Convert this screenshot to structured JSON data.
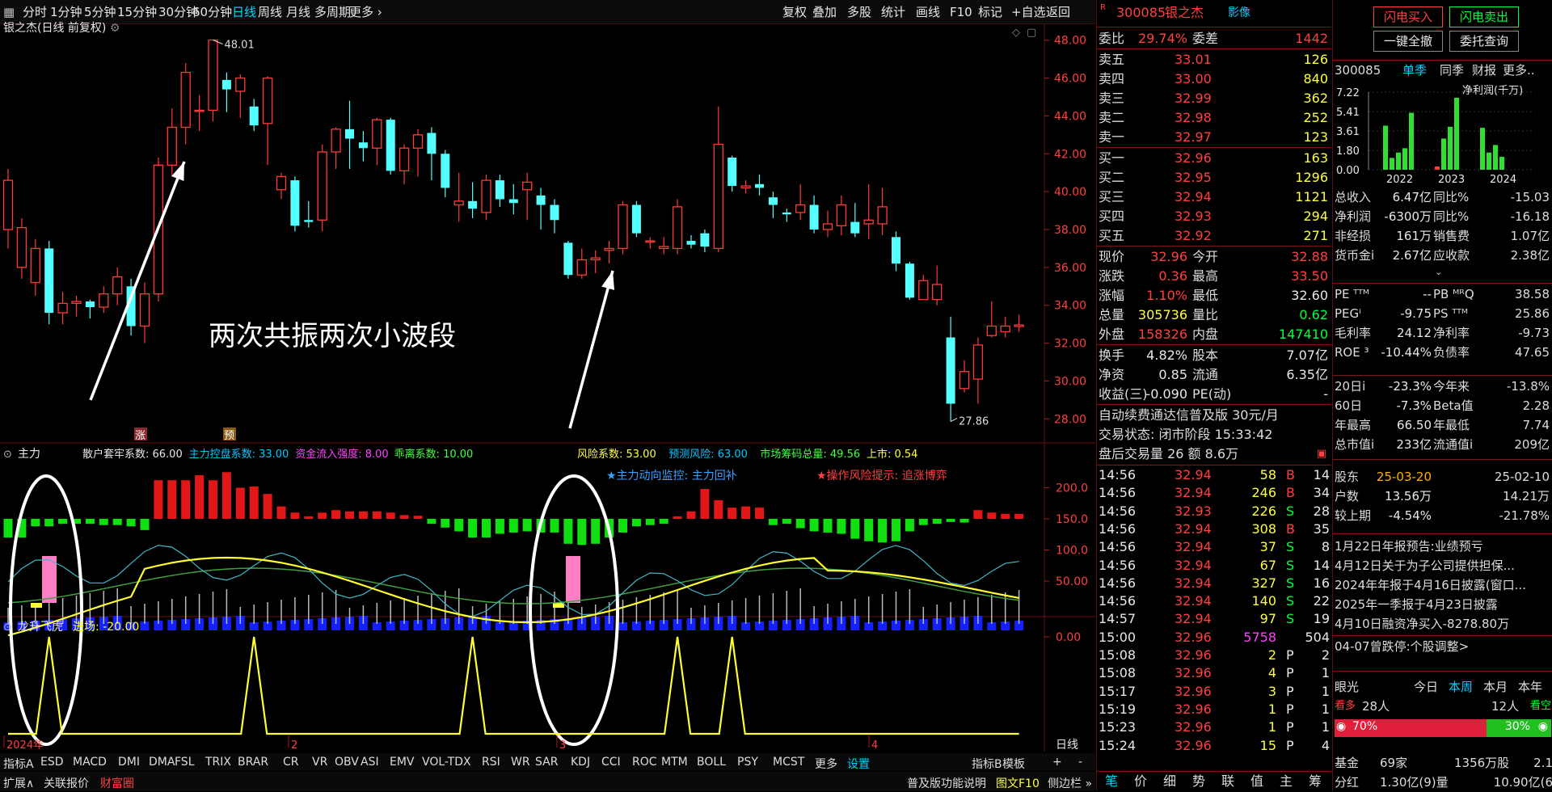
{
  "toolbar": {
    "periods": [
      "分时",
      "1分钟",
      "5分钟",
      "15分钟",
      "30分钟",
      "60分钟",
      "日线",
      "周线",
      "月线",
      "多周期",
      "更多 ›"
    ],
    "selected": "日线",
    "right": [
      "复权",
      "叠加",
      "多股",
      "统计",
      "画线",
      "F10",
      "标记",
      "+自选",
      "返回"
    ]
  },
  "chart": {
    "title": "银之杰(日线 前复权)",
    "high_label": "48.01",
    "low_label": "27.86",
    "annotation": "两次共振两次小波段",
    "price_ticks": [
      "48.00",
      "46.00",
      "44.00",
      "42.00",
      "40.00",
      "38.00",
      "36.00",
      "34.00",
      "32.00",
      "30.00",
      "28.00"
    ],
    "markers": [
      "涨",
      "预"
    ],
    "ind1_name": "主力",
    "ind1_params": [
      {
        "text": "散户套牢系数: 66.00",
        "color": "#e8e8e8"
      },
      {
        "text": "主力控盘系数: 33.00",
        "color": "#00c8ff"
      },
      {
        "text": "资金流入强度: 8.00",
        "color": "#ff40ff"
      },
      {
        "text": "乖离系数: 10.00",
        "color": "#40ff40"
      },
      {
        "text": "风险系数: 53.00",
        "color": "#ffff40"
      },
      {
        "text": "预测风险: 63.00",
        "color": "#00c8ff"
      },
      {
        "text": "市场筹码总量: 49.56",
        "color": "#40ff40"
      },
      {
        "text": "上市: 0.54",
        "color": "#ffff40"
      }
    ],
    "ind1_monitor": "★主力动向监控: 主力回补",
    "ind1_risk": "★操作风险提示: 追涨博弈",
    "ind1_ticks": [
      "200.0",
      "150.0",
      "100.0",
      "50.00"
    ],
    "ind2_name": "龙升飞虎",
    "ind2_param": "进场: -20.00",
    "ind2_tick": "0.00",
    "xlabels": [
      "2024年",
      "2",
      "3",
      "4"
    ],
    "period_label": "日线"
  },
  "chart_data": {
    "type": "candlestick",
    "symbol": "300085",
    "y_range": [
      27.5,
      48.5
    ],
    "candles": [
      [
        38.0,
        40.6,
        37.0,
        41.2
      ],
      [
        36.0,
        38.1,
        35.4,
        38.6
      ],
      [
        35.2,
        37.0,
        34.5,
        37.5
      ],
      [
        37.0,
        33.6,
        33.0,
        37.4
      ],
      [
        33.6,
        34.1,
        33.0,
        34.7
      ],
      [
        34.1,
        34.2,
        33.4,
        34.5
      ],
      [
        34.2,
        33.9,
        33.3,
        34.3
      ],
      [
        33.9,
        34.6,
        33.6,
        35.0
      ],
      [
        34.6,
        35.5,
        34.0,
        36.0
      ],
      [
        35.0,
        32.9,
        32.4,
        35.4
      ],
      [
        32.9,
        34.6,
        32.0,
        35.2
      ],
      [
        34.6,
        41.4,
        34.2,
        41.8
      ],
      [
        41.4,
        43.4,
        40.8,
        44.4
      ],
      [
        43.4,
        46.3,
        42.5,
        46.8
      ],
      [
        44.3,
        44.3,
        43.2,
        45.1
      ],
      [
        44.3,
        48.01,
        43.7,
        48.01
      ],
      [
        45.9,
        45.4,
        44.2,
        46.3
      ],
      [
        45.3,
        46.0,
        43.9,
        46.2
      ],
      [
        44.5,
        43.5,
        43.2,
        44.9
      ],
      [
        43.6,
        46.0,
        41.4,
        46.1
      ],
      [
        40.1,
        40.8,
        39.6,
        41.0
      ],
      [
        40.6,
        38.2,
        37.9,
        40.8
      ],
      [
        38.5,
        38.4,
        38.1,
        39.5
      ],
      [
        38.5,
        42.1,
        37.9,
        42.5
      ],
      [
        42.1,
        43.3,
        41.2,
        43.4
      ],
      [
        43.3,
        42.8,
        41.2,
        44.8
      ],
      [
        42.6,
        42.3,
        41.6,
        43.2
      ],
      [
        42.3,
        43.8,
        41.4,
        43.9
      ],
      [
        43.8,
        41.1,
        40.9,
        43.9
      ],
      [
        41.1,
        42.3,
        40.4,
        42.5
      ],
      [
        42.3,
        43.0,
        40.8,
        43.3
      ],
      [
        43.1,
        42.0,
        40.6,
        43.4
      ],
      [
        42.0,
        40.2,
        39.7,
        42.2
      ],
      [
        39.3,
        39.5,
        38.4,
        41.0
      ],
      [
        39.5,
        39.1,
        38.6,
        40.5
      ],
      [
        38.9,
        40.6,
        38.5,
        40.9
      ],
      [
        40.6,
        39.6,
        39.2,
        40.9
      ],
      [
        39.6,
        39.4,
        38.8,
        40.4
      ],
      [
        40.1,
        40.5,
        38.5,
        41.0
      ],
      [
        39.8,
        39.3,
        38.0,
        40.2
      ],
      [
        39.3,
        38.5,
        37.8,
        39.6
      ],
      [
        37.3,
        35.6,
        35.4,
        37.4
      ],
      [
        35.6,
        36.4,
        35.4,
        37.0
      ],
      [
        36.4,
        36.5,
        35.7,
        36.9
      ],
      [
        36.9,
        37.0,
        36.2,
        37.4
      ],
      [
        37.0,
        39.3,
        36.7,
        39.5
      ],
      [
        39.3,
        37.8,
        37.6,
        39.5
      ],
      [
        37.4,
        37.4,
        37.0,
        37.6
      ],
      [
        37.0,
        37.1,
        36.7,
        37.6
      ],
      [
        37.0,
        39.2,
        36.7,
        39.6
      ],
      [
        37.4,
        37.2,
        37.0,
        37.7
      ],
      [
        37.8,
        37.1,
        36.8,
        38.0
      ],
      [
        37.0,
        42.5,
        36.8,
        44.5
      ],
      [
        41.8,
        40.3,
        40.0,
        41.9
      ],
      [
        40.2,
        40.3,
        39.9,
        40.6
      ],
      [
        40.4,
        40.2,
        39.8,
        40.9
      ],
      [
        39.7,
        39.3,
        38.6,
        40.0
      ],
      [
        38.9,
        38.8,
        38.4,
        39.1
      ],
      [
        38.9,
        39.3,
        38.5,
        40.4
      ],
      [
        39.3,
        38.0,
        37.8,
        39.8
      ],
      [
        38.0,
        38.3,
        37.6,
        39.0
      ],
      [
        38.2,
        39.3,
        37.7,
        39.8
      ],
      [
        38.4,
        37.8,
        37.6,
        39.4
      ],
      [
        38.3,
        38.5,
        37.5,
        40.4
      ],
      [
        38.3,
        39.2,
        37.7,
        40.2
      ],
      [
        37.6,
        36.2,
        35.8,
        37.9
      ],
      [
        36.2,
        34.4,
        34.3,
        36.3
      ],
      [
        34.3,
        35.3,
        34.3,
        35.6
      ],
      [
        34.3,
        35.1,
        34.0,
        36.1
      ],
      [
        32.3,
        28.8,
        27.86,
        33.4
      ],
      [
        29.6,
        30.5,
        29.4,
        31.1
      ],
      [
        30.1,
        31.9,
        28.8,
        32.3
      ],
      [
        32.4,
        32.9,
        32.3,
        34.2
      ],
      [
        32.6,
        32.9,
        32.3,
        33.4
      ],
      [
        32.88,
        32.96,
        32.6,
        33.5
      ]
    ]
  },
  "quote": {
    "code": "300085",
    "name": "银之杰",
    "tag": "影像",
    "weibi_label": "委比",
    "weibi": "29.74%",
    "weicha_label": "委差",
    "weicha": "1442",
    "asks": [
      {
        "l": "卖五",
        "p": "33.01",
        "v": "126"
      },
      {
        "l": "卖四",
        "p": "33.00",
        "v": "840"
      },
      {
        "l": "卖三",
        "p": "32.99",
        "v": "362"
      },
      {
        "l": "卖二",
        "p": "32.98",
        "v": "252"
      },
      {
        "l": "卖一",
        "p": "32.97",
        "v": "123"
      }
    ],
    "bids": [
      {
        "l": "买一",
        "p": "32.96",
        "v": "163"
      },
      {
        "l": "买二",
        "p": "32.95",
        "v": "1296"
      },
      {
        "l": "买三",
        "p": "32.94",
        "v": "1121"
      },
      {
        "l": "买四",
        "p": "32.93",
        "v": "294"
      },
      {
        "l": "买五",
        "p": "32.92",
        "v": "271"
      }
    ],
    "stats": [
      {
        "a": "现价",
        "av": "32.96",
        "ac": "red",
        "b": "今开",
        "bv": "32.88",
        "bc": "red"
      },
      {
        "a": "涨跌",
        "av": "0.36",
        "ac": "red",
        "b": "最高",
        "bv": "33.50",
        "bc": "red"
      },
      {
        "a": "涨幅",
        "av": "1.10%",
        "ac": "red",
        "b": "最低",
        "bv": "32.60",
        "bc": "wht"
      },
      {
        "a": "总量",
        "av": "305736",
        "ac": "yel",
        "b": "量比",
        "bv": "0.62",
        "bc": "grn"
      },
      {
        "a": "外盘",
        "av": "158326",
        "ac": "red",
        "b": "内盘",
        "bv": "147410",
        "bc": "grn"
      }
    ],
    "stats2": [
      {
        "a": "换手",
        "av": "4.82%",
        "b": "股本",
        "bv": "7.07亿"
      },
      {
        "a": "净资",
        "av": "0.85",
        "b": "流通",
        "bv": "6.35亿"
      },
      {
        "a": "收益(三)",
        "av": "-0.090",
        "b": "PE(动)",
        "bv": "-"
      }
    ],
    "ad": "自动续费通达信普及版 30元/月",
    "status": "交易状态: 闭市阶段 15:33:42",
    "afterhours": "盘后交易量 26 额 8.6万",
    "ticks": [
      [
        "14:56",
        "32.94",
        "58",
        "B",
        "14"
      ],
      [
        "14:56",
        "32.94",
        "246",
        "B",
        "34"
      ],
      [
        "14:56",
        "32.93",
        "226",
        "S",
        "28"
      ],
      [
        "14:56",
        "32.94",
        "308",
        "B",
        "35"
      ],
      [
        "14:56",
        "32.94",
        "37",
        "S",
        "8"
      ],
      [
        "14:56",
        "32.94",
        "67",
        "S",
        "14"
      ],
      [
        "14:56",
        "32.94",
        "327",
        "S",
        "16"
      ],
      [
        "14:56",
        "32.94",
        "140",
        "S",
        "22"
      ],
      [
        "14:57",
        "32.94",
        "97",
        "S",
        "19"
      ],
      [
        "15:00",
        "32.96",
        "5758",
        "",
        "504"
      ],
      [
        "15:08",
        "32.96",
        "2",
        "P",
        "2"
      ],
      [
        "15:08",
        "32.96",
        "4",
        "P",
        "1"
      ],
      [
        "15:17",
        "32.96",
        "3",
        "P",
        "1"
      ],
      [
        "15:19",
        "32.96",
        "1",
        "P",
        "1"
      ],
      [
        "15:23",
        "32.96",
        "1",
        "P",
        "1"
      ],
      [
        "15:24",
        "32.96",
        "15",
        "P",
        "4"
      ]
    ],
    "bottom_tabs": [
      "笔",
      "价",
      "细",
      "势",
      "联",
      "值",
      "主",
      "筹"
    ]
  },
  "fin": {
    "btn_buy": "闪电买入",
    "btn_sell": "闪电卖出",
    "btn_cancel": "一键全撤",
    "btn_query": "委托查询",
    "code": "300085",
    "tabs": [
      "单季",
      "同季",
      "财报",
      "更多.."
    ],
    "chart_title": "净利润(千万)",
    "y_ticks": [
      "7.22",
      "5.41",
      "3.61",
      "1.80",
      "0.00"
    ],
    "years": [
      "2022",
      "2023",
      "2024"
    ],
    "rows": [
      {
        "a": "总收入",
        "av": "6.47亿",
        "b": "同比%",
        "bv": "-15.03"
      },
      {
        "a": "净利润",
        "av": "-6300万",
        "b": "同比%",
        "bv": "-16.18"
      },
      {
        "a": "非经损",
        "av": "161万",
        "b": "销售费",
        "bv": "1.07亿"
      },
      {
        "a": "货币金i",
        "av": "2.67亿",
        "b": "应收款",
        "bv": "2.38亿"
      }
    ],
    "rows2": [
      {
        "a": "PE ᵀᵀᴹ",
        "av": "--",
        "b": "PB ᴹᴿQ",
        "bv": "38.58"
      },
      {
        "a": "PEGⁱ",
        "av": "-9.75",
        "b": "PS ᵀᵀᴹ",
        "bv": "25.86"
      },
      {
        "a": "毛利率",
        "av": "24.12",
        "b": "净利率",
        "bv": "-9.73"
      },
      {
        "a": "ROE ³",
        "av": "-10.44%",
        "b": "负债率",
        "bv": "47.65"
      }
    ],
    "rows3": [
      {
        "a": "20日i",
        "av": "-23.3%",
        "b": "今年来",
        "bv": "-13.8%"
      },
      {
        "a": "60日",
        "av": "-7.3%",
        "b": "Beta值",
        "bv": "2.28"
      },
      {
        "a": "年最高",
        "av": "66.50",
        "b": "年最低",
        "bv": "7.74"
      },
      {
        "a": "总市值i",
        "av": "233亿",
        "b": "流通值i",
        "bv": "209亿"
      }
    ],
    "rows4": [
      {
        "a": "股东",
        "av": "25-03-20",
        "b": "",
        "bv": "25-02-10"
      },
      {
        "a": "户数",
        "av": "13.56万",
        "b": "",
        "bv": "14.21万"
      },
      {
        "a": "较上期",
        "av": "-4.54%",
        "b": "",
        "bv": "-21.78%"
      }
    ],
    "news": [
      "1月22日年报预告:业绩预亏",
      "4月12日关于为子公司提供担保...",
      "2024年年报于4月16日披露(窗口...",
      "2025年一季报于4月23日披露",
      "4月10日融资净买入-8278.80万"
    ],
    "limit": "04-07曾跌停:个股调整>",
    "eye": "眼光",
    "eye_tabs": [
      "今日",
      "本周",
      "本月",
      "本年"
    ],
    "bull": "看多",
    "bull_n": "28人",
    "bear_n": "12人",
    "bear": "看空",
    "bull_pct": "70%",
    "bear_pct": "30%",
    "fund_label": "基金",
    "fund_n": "69家",
    "fund_v": "1356万股",
    "fund_r": "2.1",
    "div_label": "分红",
    "div_v": "1.30亿(9)量",
    "div_r": "10.90亿(6"
  },
  "bottom": {
    "ind_tabs": [
      "指标A",
      "ESD",
      "MACD",
      "DMI",
      "DMA",
      "FSL",
      "TRIX",
      "BRAR",
      "CR",
      "VR",
      "OBV",
      "ASI",
      "EMV",
      "VOL-TDX",
      "RSI",
      "WR",
      "SAR",
      "KDJ",
      "CCI",
      "ROC",
      "MTM",
      "BOLL",
      "PSY",
      "MCST",
      "更多",
      "设置"
    ],
    "right_tabs": [
      "指标B",
      "模板",
      "+",
      "-"
    ],
    "row2": [
      "扩展∧",
      "关联报价",
      "财富圈"
    ],
    "row2_right": [
      "普及版功能说明",
      "图文F10",
      "侧边栏 »"
    ]
  }
}
